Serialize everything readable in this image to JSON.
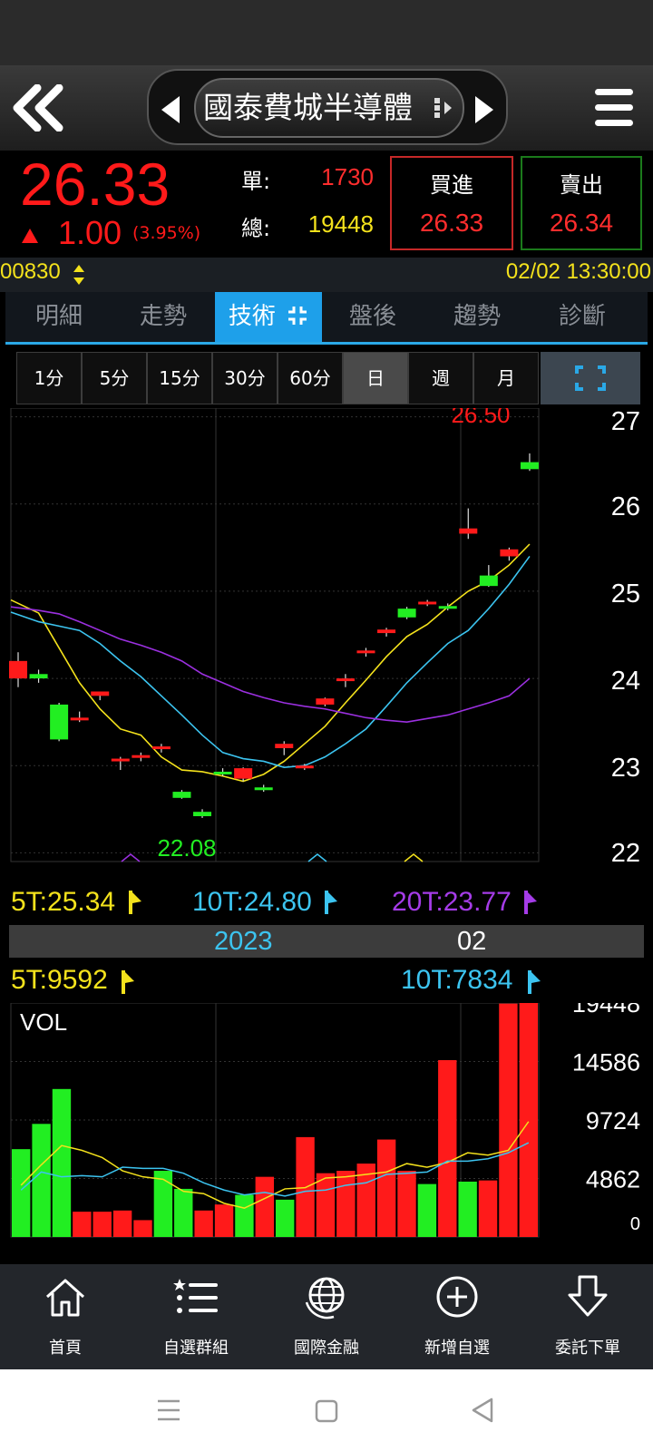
{
  "header": {
    "stock_name": "國泰費城半導體"
  },
  "quote": {
    "price": "26.33",
    "change": "1.00",
    "change_pct": "(3.95%)",
    "single_label": "單:",
    "single_value": "1730",
    "total_label": "總:",
    "total_value": "19448",
    "buy_label": "買進",
    "buy_price": "26.33",
    "sell_label": "賣出",
    "sell_price": "26.34"
  },
  "info": {
    "code": "00830",
    "datetime": "02/02 13:30:00"
  },
  "tabs": [
    {
      "label": "明細"
    },
    {
      "label": "走勢"
    },
    {
      "label": "技術",
      "active": true
    },
    {
      "label": "盤後"
    },
    {
      "label": "趨勢"
    },
    {
      "label": "診斷"
    }
  ],
  "periods": [
    "1分",
    "5分",
    "15分",
    "30分",
    "60分",
    "日",
    "週",
    "月"
  ],
  "active_period": "日",
  "colors": {
    "up": "#ff1a1a",
    "down": "#22ee22",
    "ma5": "#f4e21c",
    "ma10": "#3cc4f0",
    "ma20": "#9b30e0",
    "accent": "#1ea0ea"
  },
  "chart_data": {
    "type": "candlestick",
    "y_ticks": [
      "27",
      "26",
      "25",
      "24",
      "23",
      "22"
    ],
    "ylim": [
      21.9,
      27.1
    ],
    "high_label": "26.50",
    "low_label": "22.08",
    "candles": [
      {
        "o": 24.0,
        "h": 24.3,
        "l": 23.9,
        "c": 24.2
      },
      {
        "o": 24.05,
        "h": 24.1,
        "l": 23.95,
        "c": 24.0
      },
      {
        "o": 23.7,
        "h": 23.72,
        "l": 23.28,
        "c": 23.3
      },
      {
        "o": 23.55,
        "h": 23.62,
        "l": 23.5,
        "c": 23.55
      },
      {
        "o": 23.8,
        "h": 23.85,
        "l": 23.75,
        "c": 23.85
      },
      {
        "o": 23.05,
        "h": 23.1,
        "l": 22.95,
        "c": 23.08
      },
      {
        "o": 23.1,
        "h": 23.15,
        "l": 23.05,
        "c": 23.12
      },
      {
        "o": 23.2,
        "h": 23.25,
        "l": 23.15,
        "c": 23.22
      },
      {
        "o": 22.7,
        "h": 22.72,
        "l": 22.62,
        "c": 22.63
      },
      {
        "o": 22.47,
        "h": 22.5,
        "l": 22.4,
        "c": 22.42
      },
      {
        "o": 22.93,
        "h": 22.97,
        "l": 22.88,
        "c": 22.9
      },
      {
        "o": 22.85,
        "h": 22.98,
        "l": 22.82,
        "c": 22.97
      },
      {
        "o": 22.75,
        "h": 22.78,
        "l": 22.7,
        "c": 22.72
      },
      {
        "o": 23.2,
        "h": 23.28,
        "l": 23.12,
        "c": 23.25
      },
      {
        "o": 22.98,
        "h": 23.02,
        "l": 22.95,
        "c": 23.0
      },
      {
        "o": 23.7,
        "h": 23.78,
        "l": 23.68,
        "c": 23.77
      },
      {
        "o": 24.0,
        "h": 24.05,
        "l": 23.9,
        "c": 24.0
      },
      {
        "o": 24.3,
        "h": 24.35,
        "l": 24.25,
        "c": 24.32
      },
      {
        "o": 24.52,
        "h": 24.58,
        "l": 24.48,
        "c": 24.56
      },
      {
        "o": 24.8,
        "h": 24.82,
        "l": 24.68,
        "c": 24.7
      },
      {
        "o": 24.85,
        "h": 24.9,
        "l": 24.83,
        "c": 24.88
      },
      {
        "o": 24.83,
        "h": 24.86,
        "l": 24.78,
        "c": 24.82
      },
      {
        "o": 25.66,
        "h": 25.95,
        "l": 25.6,
        "c": 25.72
      },
      {
        "o": 25.18,
        "h": 25.3,
        "l": 25.05,
        "c": 25.06
      },
      {
        "o": 25.4,
        "h": 25.5,
        "l": 25.35,
        "c": 25.48
      },
      {
        "o": 26.48,
        "h": 26.58,
        "l": 26.38,
        "c": 26.4
      }
    ],
    "series": [
      {
        "name": "5T",
        "values": [
          24.9,
          24.75,
          24.35,
          23.95,
          23.65,
          23.42,
          23.35,
          23.1,
          22.95,
          22.93,
          22.88,
          22.82,
          22.9,
          23.05,
          23.25,
          23.45,
          23.72,
          23.98,
          24.25,
          24.48,
          24.62,
          24.82,
          25.0,
          25.12,
          25.3,
          25.54
        ]
      },
      {
        "name": "10T",
        "values": [
          24.76,
          24.65,
          24.6,
          24.55,
          24.4,
          24.2,
          24.02,
          23.8,
          23.58,
          23.35,
          23.15,
          23.08,
          23.05,
          22.98,
          23.0,
          23.1,
          23.25,
          23.42,
          23.68,
          23.95,
          24.18,
          24.4,
          24.55,
          24.8,
          25.08,
          25.4
        ]
      },
      {
        "name": "20T",
        "values": [
          24.82,
          24.78,
          24.74,
          24.65,
          24.55,
          24.45,
          24.38,
          24.3,
          24.2,
          24.05,
          23.95,
          23.85,
          23.78,
          23.72,
          23.68,
          23.65,
          23.6,
          23.55,
          23.52,
          23.5,
          23.54,
          23.58,
          23.65,
          23.72,
          23.8,
          24.0
        ]
      }
    ],
    "ma_labels": {
      "ma5": "5T:25.34",
      "ma10": "10T:24.80",
      "ma20": "20T:23.77"
    },
    "x_labels": {
      "year": "2023",
      "month": "02"
    }
  },
  "volume_chart": {
    "title": "VOL",
    "ma_labels": {
      "ma5": "5T:9592",
      "ma10": "10T:7834"
    },
    "y_ticks": [
      "19448",
      "14586",
      "9724",
      "4862",
      "0"
    ],
    "ymax": 19448,
    "volumes": [
      7300,
      9400,
      12300,
      2100,
      2100,
      2200,
      1400,
      5500,
      4000,
      2200,
      2700,
      3500,
      5000,
      3100,
      8300,
      5300,
      5500,
      6100,
      8100,
      5500,
      4400,
      14700,
      4600,
      4700,
      19400,
      19448
    ],
    "up": [
      false,
      false,
      false,
      true,
      true,
      true,
      true,
      false,
      false,
      true,
      true,
      false,
      true,
      false,
      true,
      true,
      true,
      true,
      true,
      true,
      false,
      true,
      false,
      true,
      true,
      true
    ],
    "ma5": [
      4300,
      6000,
      7600,
      7200,
      6600,
      5500,
      5000,
      4800,
      3800,
      3600,
      2800,
      2400,
      3200,
      4000,
      4100,
      4900,
      5000,
      5200,
      5400,
      6100,
      5800,
      6200,
      7000,
      6800,
      7200,
      9592
    ],
    "ma10": [
      3900,
      5400,
      5000,
      5100,
      5000,
      5800,
      5700,
      5700,
      5300,
      4500,
      3900,
      3500,
      3700,
      3400,
      3800,
      3900,
      4300,
      4500,
      5200,
      5300,
      5400,
      6300,
      6300,
      6500,
      7000,
      7834
    ]
  },
  "bottom_nav": [
    {
      "label": "首頁",
      "icon": "home-icon"
    },
    {
      "label": "自選群組",
      "icon": "watchlist-icon"
    },
    {
      "label": "國際金融",
      "icon": "globe-icon"
    },
    {
      "label": "新增自選",
      "icon": "add-circle-icon"
    },
    {
      "label": "委託下單",
      "icon": "order-arrow-icon"
    }
  ]
}
